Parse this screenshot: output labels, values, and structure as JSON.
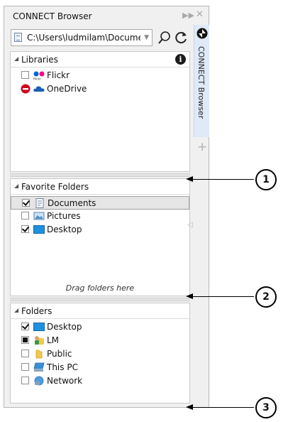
{
  "window": {
    "title": "CONNECT Browser"
  },
  "toolbar": {
    "path": "C:\\Users\\ludmilam\\Documents"
  },
  "libraries": {
    "header": "Libraries",
    "items": [
      {
        "label": "Flickr",
        "state": "unchecked",
        "icon": "flickr-icon"
      },
      {
        "label": "OneDrive",
        "state": "blocked",
        "icon": "onedrive-cloud-icon"
      }
    ]
  },
  "favorites": {
    "header": "Favorite Folders",
    "items": [
      {
        "label": "Documents",
        "checked": true,
        "selected": true,
        "icon": "documents-folder-icon"
      },
      {
        "label": "Pictures",
        "checked": false,
        "icon": "pictures-folder-icon"
      },
      {
        "label": "Desktop",
        "checked": true,
        "icon": "desktop-folder-icon"
      }
    ],
    "drag_hint": "Drag folders here"
  },
  "folders": {
    "header": "Folders",
    "items": [
      {
        "label": "Desktop",
        "state": "checked",
        "icon": "desktop-folder-icon"
      },
      {
        "label": "LM",
        "state": "partial",
        "icon": "user-folder-icon"
      },
      {
        "label": "Public",
        "state": "unchecked",
        "icon": "folder-icon"
      },
      {
        "label": "This PC",
        "state": "unchecked",
        "icon": "computer-icon"
      },
      {
        "label": "Network",
        "state": "unchecked",
        "icon": "network-icon"
      }
    ]
  },
  "side_tab": {
    "label": "CONNECT Browser"
  },
  "callouts": [
    "1",
    "2",
    "3"
  ],
  "colors": {
    "desktop_blue": "#1e90e0",
    "folder_yellow": "#f2c94c",
    "flickr_blue": "#0063dc",
    "flickr_pink": "#ff0084",
    "onedrive_blue": "#1b5fb8",
    "blocked_red": "#d0021b",
    "side_tab_bg": "#dfe9f7"
  }
}
